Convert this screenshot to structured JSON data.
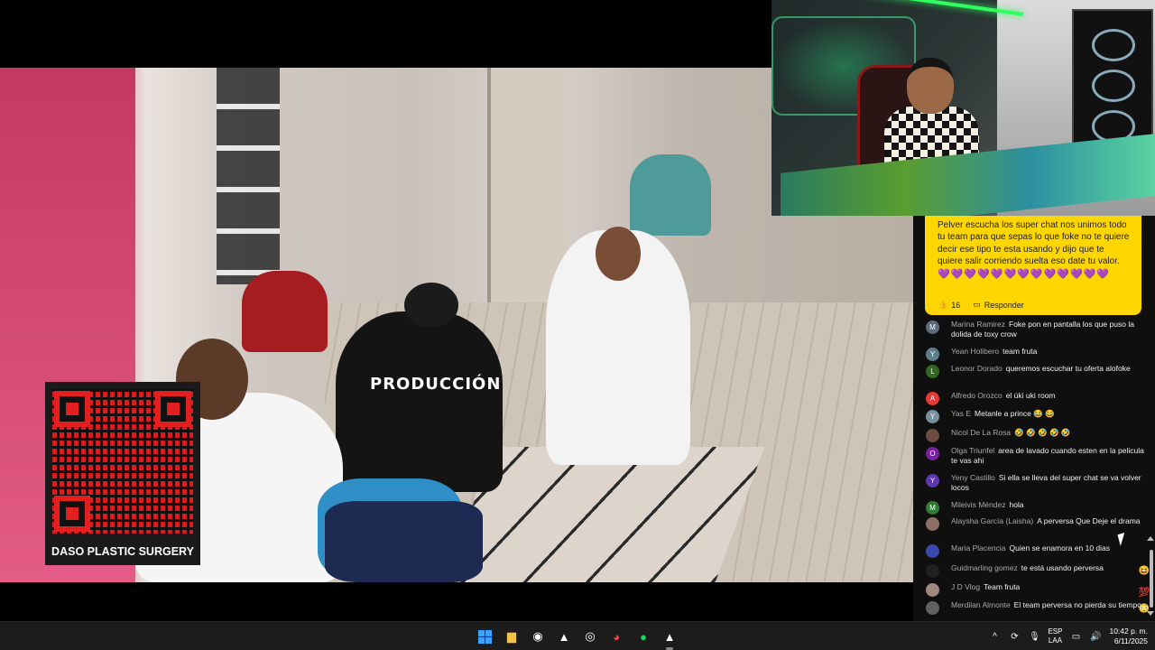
{
  "video": {
    "shirt_text": "PRODUCCIÓN",
    "qr_label": "DASO PLASTIC SURGERY"
  },
  "superchat": {
    "text": "Pelver escucha los super chat nos unimos todo tu team para que sepas lo que foke no te quiere decir ese tipo te esta usando y dijo que te quiere salir corriendo suelta eso date tu valor.",
    "emoji": "💜💜💜💜💜💜💜💜💜💜💜💜💜",
    "likes": "16",
    "reply_label": "Responder",
    "like_icon": "thumbs-up-icon",
    "reply_icon": "reply-icon"
  },
  "chat": {
    "messages": [
      {
        "avatar": "M",
        "color": "#5c6b7a",
        "author": "Marina Ramirez",
        "text": "Foke pon en pantalla los que puso la dolida de toxy crow"
      },
      {
        "avatar": "Y",
        "color": "#607d8b",
        "author": "Yean Holibero",
        "text": "team fruta"
      },
      {
        "avatar": "L",
        "color": "#33691e",
        "author": "Leonor Dorado",
        "text": "queremos escuchar tu oferta alofoke"
      },
      {
        "avatar": "A",
        "color": "#e53935",
        "author": "Alfredo Orozco",
        "text": "el úki uki room"
      },
      {
        "avatar": "Y",
        "color": "#78909c",
        "author": "Yas E",
        "text": "Metanle a prince 😂 😂"
      },
      {
        "avatar": "",
        "color": "#6d4c41",
        "author": "Nicol De La Rosa",
        "text": "🤣 🤣 🤣 🤣 🤣"
      },
      {
        "avatar": "O",
        "color": "#7b1fa2",
        "author": "Olga Triunfel",
        "text": "area de lavado cuando esten en la pelicula te vas ahi"
      },
      {
        "avatar": "Y",
        "color": "#5e35b1",
        "author": "Yeny Castillo",
        "text": "Si ella se lleva del super chat se va volver locos"
      },
      {
        "avatar": "M",
        "color": "#2e7d32",
        "author": "Mileivis Méndez",
        "text": "hola"
      },
      {
        "avatar": "",
        "color": "#8d6e63",
        "author": "Alaysha García (Laisha)",
        "text": "A perversa Que Deje el drama"
      },
      {
        "avatar": "",
        "color": "#3949ab",
        "author": "Maria Placencia",
        "text": "Quien se enamora en 10 dias"
      },
      {
        "avatar": "",
        "color": "#212121",
        "author": "Guidmarling gomez",
        "text": "te está usando perversa"
      },
      {
        "avatar": "",
        "color": "#a1887f",
        "author": "J D Vlog",
        "text": "Team fruta"
      },
      {
        "avatar": "",
        "color": "#616161",
        "author": "Merdilan Almonte",
        "text": "El team perversa no pierda su tiempo"
      }
    ],
    "floating": [
      "😆",
      "💯",
      "😳"
    ]
  },
  "taskbar": {
    "apps": [
      "start-icon",
      "file-explorer-icon",
      "obs-icon",
      "app-triangle-icon",
      "steam-icon",
      "chrome-icon",
      "spotify-icon",
      "app-active-icon"
    ],
    "lang_top": "ESP",
    "lang_bottom": "LAA",
    "time": "10:42 p. m.",
    "date": "6/11/2025"
  }
}
